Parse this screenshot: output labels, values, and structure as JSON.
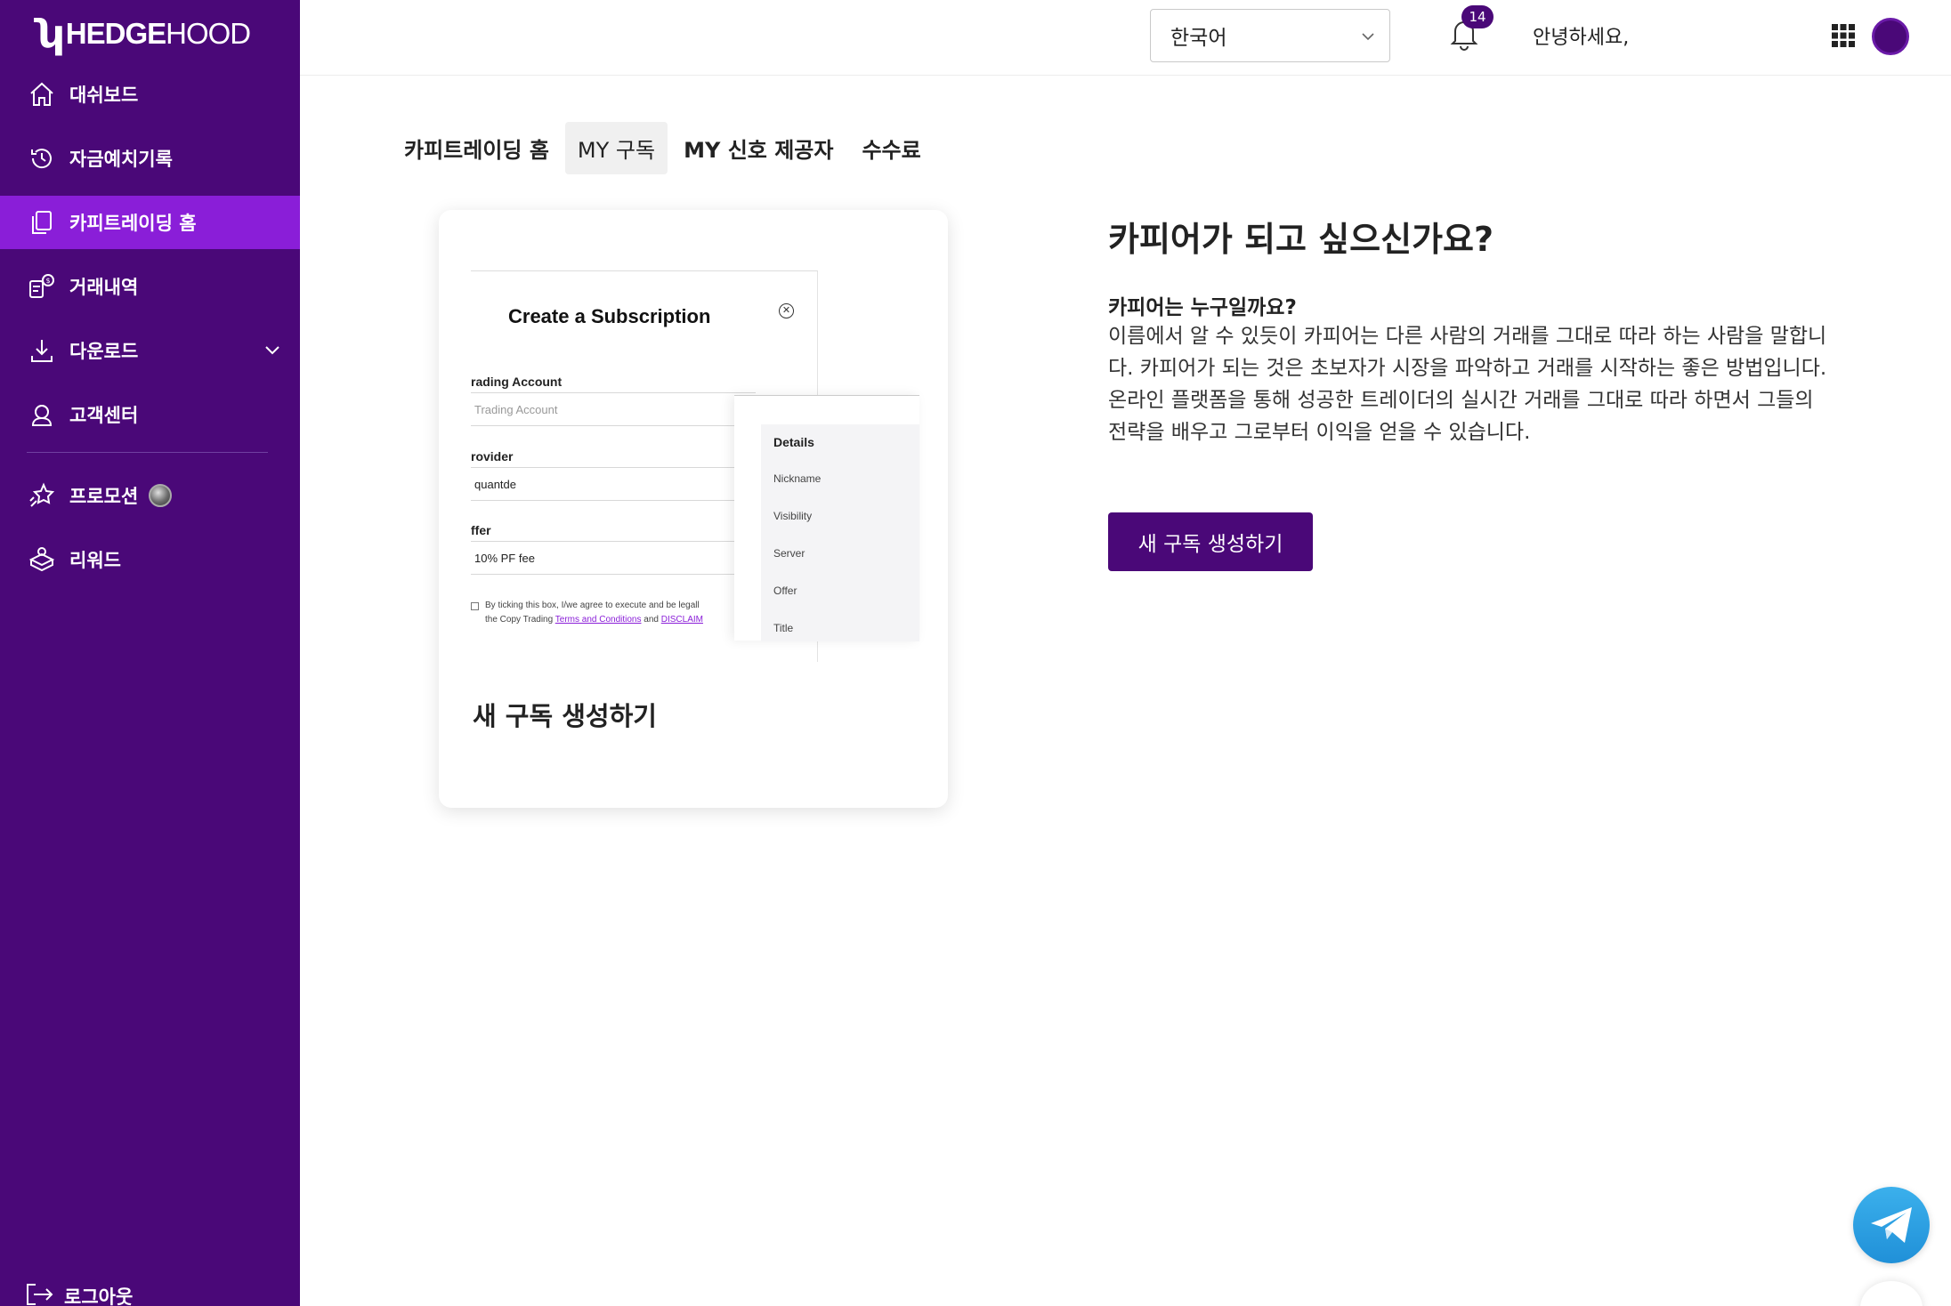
{
  "brand": {
    "logo_text_bold": "HEDGE",
    "logo_text_light": "HOOD",
    "primary_color": "#4a0878",
    "active_color": "#8a1ed8"
  },
  "sidebar": {
    "items": [
      {
        "label": "대쉬보드",
        "icon": "home-icon"
      },
      {
        "label": "자금예치기록",
        "icon": "history-icon"
      },
      {
        "label": "카피트레이딩 홈",
        "icon": "copy-icon",
        "active": true
      },
      {
        "label": "거래내역",
        "icon": "trade-history-icon"
      },
      {
        "label": "다운로드",
        "icon": "download-icon"
      },
      {
        "label": "고객센터",
        "icon": "support-icon"
      },
      {
        "label": "프로모션",
        "icon": "promotion-icon"
      },
      {
        "label": "리워드",
        "icon": "reward-icon"
      }
    ],
    "logout_label": "로그아웃"
  },
  "header": {
    "language": "한국어",
    "notification_count": "14",
    "greeting": "안녕하세요,"
  },
  "tabs": [
    {
      "label": "카피트레이딩 홈"
    },
    {
      "label": "MY 구독",
      "active": true
    },
    {
      "label": "MY 신호 제공자"
    },
    {
      "label": "수수료"
    }
  ],
  "preview": {
    "modal_title": "Create a Subscription",
    "fields": [
      {
        "label": "rading Account",
        "value": "Trading Account",
        "placeholder": true
      },
      {
        "label": "rovider",
        "value": "quantde"
      },
      {
        "label": "ffer",
        "value": "10% PF fee"
      }
    ],
    "terms_line1": "By ticking this box, I/we agree to execute and be legall",
    "terms_line2_prefix": "the Copy Trading ",
    "terms_link1": "Terms and Conditions",
    "terms_and": " and ",
    "terms_link2": "DISCLAIM",
    "details": {
      "heading": "Details",
      "items": [
        "Nickname",
        "Visibility",
        "Server",
        "Offer",
        "Title"
      ]
    },
    "caption": "새 구독 생성하기"
  },
  "info": {
    "title": "카피어가 되고 싶으신가요?",
    "subtitle": "카피어는 누구일까요?",
    "body": "이름에서 알 수 있듯이 카피어는 다른 사람의 거래를 그대로 따라 하는 사람을 말합니다. 카피어가 되는 것은 초보자가 시장을 파악하고 거래를 시작하는 좋은 방법입니다. 온라인 플랫폼을 통해 성공한 트레이더의 실시간 거래를 그대로 따라 하면서 그들의 전략을 배우고 그로부터 이익을 얻을 수 있습니다.",
    "cta_label": "새 구독 생성하기"
  }
}
